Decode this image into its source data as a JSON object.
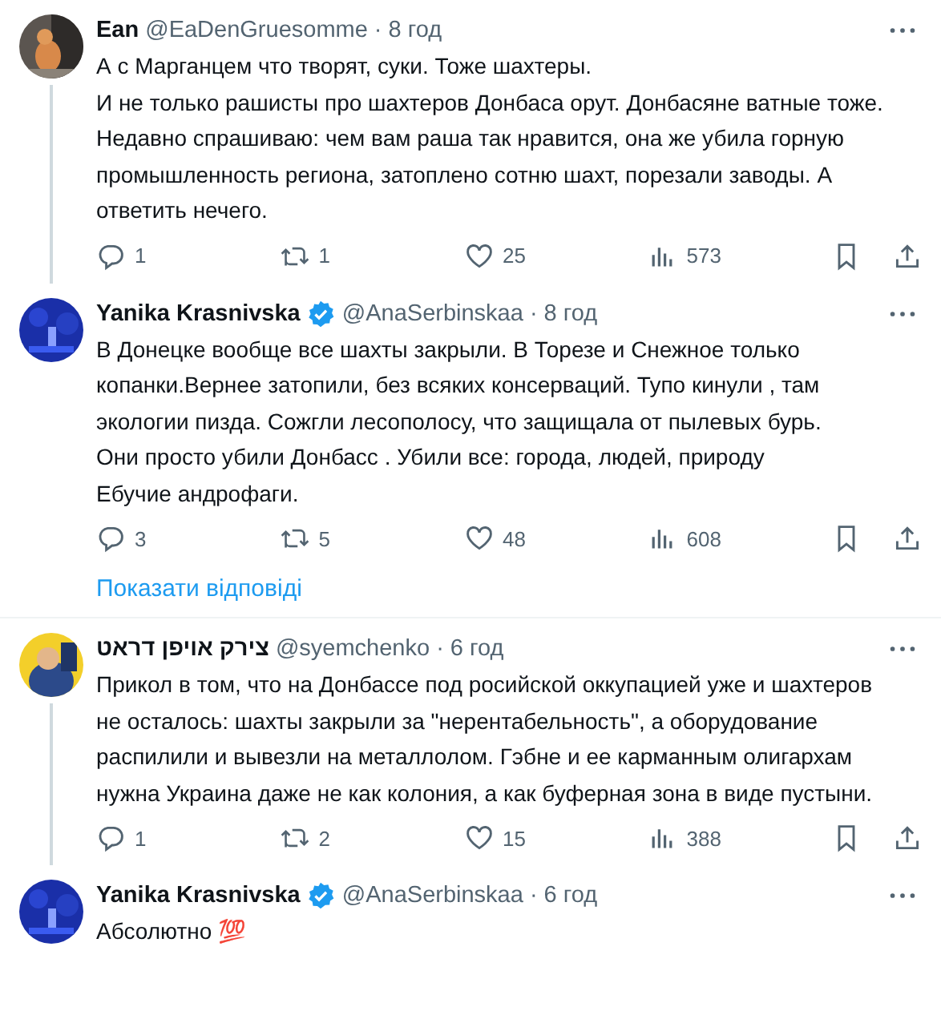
{
  "thread": [
    {
      "kind": "tweet",
      "name": "Ean",
      "verified": false,
      "handle": "@EaDenGruesomme",
      "time": "· 8 год",
      "text": "А с Марганцем что творят, суки. Тоже шахтеры.\nИ не только рашисты про шахтеров Донбаса орут. Донбасяне ватные тоже. Недавно спрашиваю: чем вам раша так нравится, она же убила горную промышленность региона, затоплено сотню шахт, порезали заводы. А ответить нечего.",
      "thread_continues": true,
      "actions": {
        "replies": "1",
        "reposts": "1",
        "likes": "25",
        "views": "573"
      }
    },
    {
      "kind": "tweet",
      "name": "Yanika Krasnivska",
      "verified": true,
      "handle": "@AnaSerbinskaa",
      "time": "· 8 год",
      "text": "В Донецке вообще все шахты закрыли.  В Торезе и Снежное только копанки.Вернее затопили, без всяких консерваций. Тупо кинули , там экологии пизда. Сожгли лесополосу, что защищала от пылевых бурь.\nОни просто убили Донбасс . Убили все: города, людей, природу\nЕбучие андрофаги.",
      "thread_continues": false,
      "actions": {
        "replies": "3",
        "reposts": "5",
        "likes": "48",
        "views": "608"
      }
    },
    {
      "kind": "show_replies",
      "label": "Показати відповіді"
    },
    {
      "kind": "tweet",
      "name": "צירק אויפן דראט",
      "verified": false,
      "handle": "@syemchenko",
      "time": "· 6 год",
      "text": "Прикол в том, что на Донбассе под росийской оккупацией уже и шахтеров не осталось: шахты закрыли за \"нерентабельность\", а оборудование распилили и вывезли на металлолом. Гэбне и ее карманным олигархам нужна Украина даже не как колония, а как буферная зона в виде пустыни.",
      "thread_continues": true,
      "actions": {
        "replies": "1",
        "reposts": "2",
        "likes": "15",
        "views": "388"
      }
    },
    {
      "kind": "tweet",
      "name": "Yanika Krasnivska",
      "verified": true,
      "handle": "@AnaSerbinskaa",
      "time": "· 6 год",
      "text": "Абсолютно 💯",
      "thread_continues": false
    }
  ]
}
